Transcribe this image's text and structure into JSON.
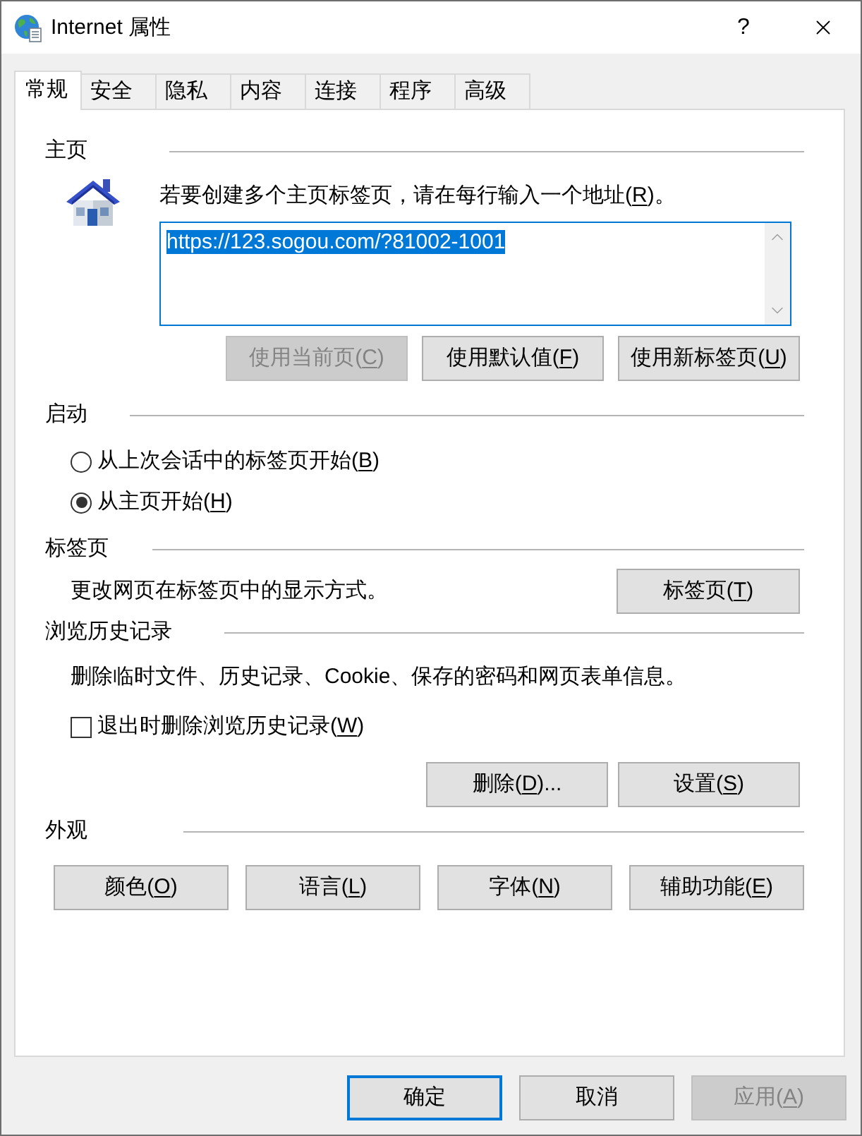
{
  "window": {
    "title": "Internet 属性",
    "help_button": "?"
  },
  "tabs": [
    {
      "label": "常规",
      "selected": true
    },
    {
      "label": "安全",
      "selected": false
    },
    {
      "label": "隐私",
      "selected": false
    },
    {
      "label": "内容",
      "selected": false
    },
    {
      "label": "连接",
      "selected": false
    },
    {
      "label": "程序",
      "selected": false
    },
    {
      "label": "高级",
      "selected": false
    }
  ],
  "home_page": {
    "heading": "主页",
    "instruction": "若要创建多个主页标签页，请在每行输入一个地址(R)。",
    "address_box": {
      "value": "https://123.sogou.com/?81002-1001",
      "text_selected": true
    },
    "buttons": [
      {
        "label": "使用当前页(C)",
        "disabled": true
      },
      {
        "label": "使用默认值(F)",
        "disabled": false
      },
      {
        "label": "使用新标签页(U)",
        "disabled": false
      }
    ]
  },
  "startup": {
    "heading": "启动",
    "options": [
      {
        "label": "从上次会话中的标签页开始(B)",
        "selected": false
      },
      {
        "label": "从主页开始(H)",
        "selected": true
      }
    ]
  },
  "tabs_section": {
    "heading": "标签页",
    "description": "更改网页在标签页中的显示方式。",
    "button": {
      "label": "标签页(T)",
      "disabled": false
    }
  },
  "browsing_history": {
    "heading": "浏览历史记录",
    "description": "删除临时文件、历史记录、Cookie、保存的密码和网页表单信息。",
    "delete_on_exit": {
      "label": "退出时删除浏览历史记录(W)",
      "checked": false
    },
    "buttons": [
      {
        "label": "删除(D)...",
        "disabled": false
      },
      {
        "label": "设置(S)",
        "disabled": false
      }
    ]
  },
  "appearance": {
    "heading": "外观",
    "buttons": [
      {
        "label": "颜色(O)",
        "disabled": false
      },
      {
        "label": "语言(L)",
        "disabled": false
      },
      {
        "label": "字体(N)",
        "disabled": false
      },
      {
        "label": "辅助功能(E)",
        "disabled": false
      }
    ]
  },
  "dialog_buttons": [
    {
      "label": "确定",
      "default": true,
      "disabled": false
    },
    {
      "label": "取消",
      "default": false,
      "disabled": false
    },
    {
      "label": "应用(A)",
      "default": false,
      "disabled": true
    }
  ]
}
